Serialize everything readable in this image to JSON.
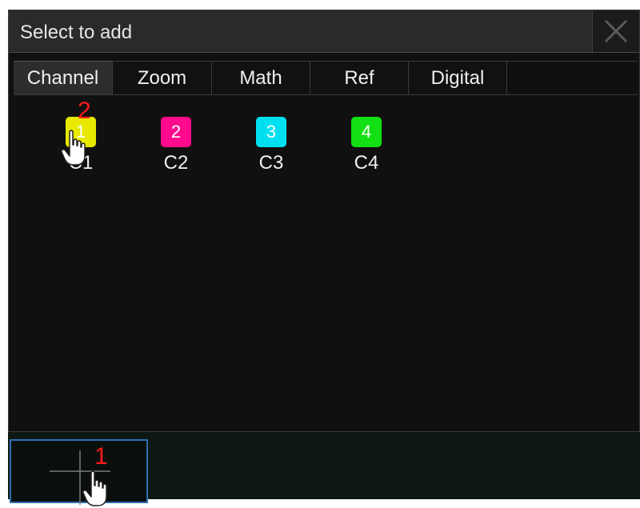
{
  "dialog": {
    "title": "Select to add",
    "close_icon": "close-icon"
  },
  "tabs": [
    {
      "label": "Channel",
      "active": true
    },
    {
      "label": "Zoom",
      "active": false
    },
    {
      "label": "Math",
      "active": false
    },
    {
      "label": "Ref",
      "active": false
    },
    {
      "label": "Digital",
      "active": false
    }
  ],
  "channels": [
    {
      "number": "1",
      "label": "C1",
      "color": "#e8e800"
    },
    {
      "number": "2",
      "label": "C2",
      "color": "#ff0a8c"
    },
    {
      "number": "3",
      "label": "C3",
      "color": "#00e0f0"
    },
    {
      "number": "4",
      "label": "C4",
      "color": "#12e012"
    }
  ],
  "annotations": {
    "step_1": "1",
    "step_2": "2"
  },
  "bottom": {
    "add_slot_icon": "plus-crosshair-icon"
  }
}
